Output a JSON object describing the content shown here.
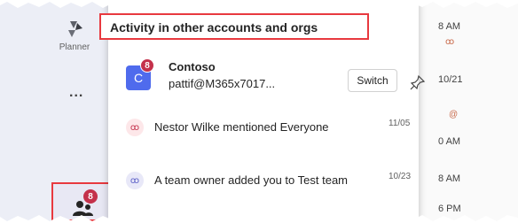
{
  "rail": {
    "planner_label": "Planner",
    "more_label": "...",
    "activity_badge": "8"
  },
  "right_column": {
    "items": [
      "8 AM",
      "10/21",
      "0 AM",
      "8 AM",
      "6 PM"
    ]
  },
  "flyout": {
    "header_title": "Activity in other accounts and orgs",
    "account": {
      "avatar_letter": "C",
      "badge": "8",
      "name": "Contoso",
      "email": "pattif@M365x7017...",
      "switch_label": "Switch"
    },
    "notifications": [
      {
        "text": "Nestor Wilke mentioned Everyone",
        "date": "11/05",
        "icon": "mention-icon"
      },
      {
        "text": "A team owner added you to Test team",
        "date": "10/23",
        "icon": "team-icon"
      }
    ]
  },
  "colors": {
    "highlight_red": "#e8393f",
    "badge_red": "#c4314b",
    "avatar_blue": "#4f6bed",
    "rail_bg": "#eceef6"
  }
}
